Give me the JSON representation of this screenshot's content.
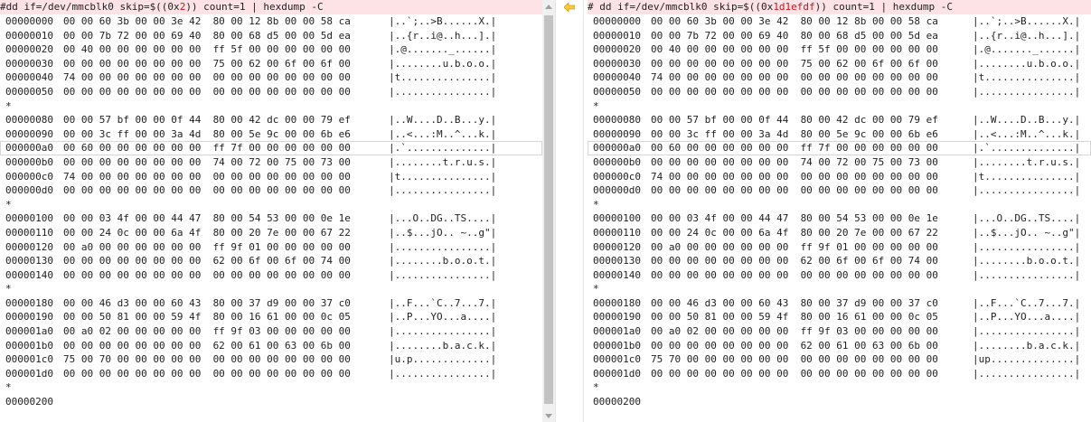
{
  "left": {
    "title_parts": [
      {
        "text": "#dd if=/dev/mmcblk0 skip=$((0x",
        "hl": false
      },
      {
        "text": "2",
        "hl": true
      },
      {
        "text": ")) count=1 | hexdump -C",
        "hl": false
      }
    ],
    "rows": [
      {
        "off": "00000000",
        "hex": "00 00 60 3b 00 00 3e 42  80 00 12 8b 00 00 58 ca",
        "asc": "|..`;..>B......X.|"
      },
      {
        "off": "00000010",
        "hex": "00 00 7b 72 00 00 69 40  80 00 68 d5 00 00 5d ea",
        "asc": "|..{r..i@..h...].|"
      },
      {
        "off": "00000020",
        "hex": "00 40 00 00 00 00 00 00  ff 5f 00 00 00 00 00 00",
        "asc": "|.@......._......|"
      },
      {
        "off": "00000030",
        "hex": "00 00 00 00 00 00 00 00  75 00 62 00 6f 00 6f 00",
        "asc": "|........u.b.o.o.|"
      },
      {
        "off": "00000040",
        "hex": "74 00 00 00 00 00 00 00  00 00 00 00 00 00 00 00",
        "asc": "|t...............|"
      },
      {
        "off": "00000050",
        "hex": "00 00 00 00 00 00 00 00  00 00 00 00 00 00 00 00",
        "asc": "|................|"
      },
      {
        "off": "*",
        "hex": "",
        "asc": ""
      },
      {
        "off": "00000080",
        "hex": "00 00 57 bf 00 00 0f 44  80 00 42 dc 00 00 79 ef",
        "asc": "|..W....D..B...y.|"
      },
      {
        "off": "00000090",
        "hex": "00 00 3c ff 00 00 3a 4d  80 00 5e 9c 00 00 6b e6",
        "asc": "|..<...:M..^...k.|"
      },
      {
        "off": "000000a0",
        "hex": "00 60 00 00 00 00 00 00  ff 7f 00 00 00 00 00 00",
        "asc": "|.`..............|"
      },
      {
        "off": "000000b0",
        "hex": "00 00 00 00 00 00 00 00  74 00 72 00 75 00 73 00",
        "asc": "|........t.r.u.s.|"
      },
      {
        "off": "000000c0",
        "hex": "74 00 00 00 00 00 00 00  00 00 00 00 00 00 00 00",
        "asc": "|t...............|"
      },
      {
        "off": "000000d0",
        "hex": "00 00 00 00 00 00 00 00  00 00 00 00 00 00 00 00",
        "asc": "|................|"
      },
      {
        "off": "*",
        "hex": "",
        "asc": ""
      },
      {
        "off": "00000100",
        "hex": "00 00 03 4f 00 00 44 47  80 00 54 53 00 00 0e 1e",
        "asc": "|...O..DG..TS....|"
      },
      {
        "off": "00000110",
        "hex": "00 00 24 0c 00 00 6a 4f  80 00 20 7e 00 00 67 22",
        "asc": "|..$...jO.. ~..g\"|"
      },
      {
        "off": "00000120",
        "hex": "00 a0 00 00 00 00 00 00  ff 9f 01 00 00 00 00 00",
        "asc": "|................|"
      },
      {
        "off": "00000130",
        "hex": "00 00 00 00 00 00 00 00  62 00 6f 00 6f 00 74 00",
        "asc": "|........b.o.o.t.|"
      },
      {
        "off": "00000140",
        "hex": "00 00 00 00 00 00 00 00  00 00 00 00 00 00 00 00",
        "asc": "|................|"
      },
      {
        "off": "*",
        "hex": "",
        "asc": ""
      },
      {
        "off": "00000180",
        "hex": "00 00 46 d3 00 00 60 43  80 00 37 d9 00 00 37 c0",
        "asc": "|..F...`C..7...7.|"
      },
      {
        "off": "00000190",
        "hex": "00 00 50 81 00 00 59 4f  80 00 16 61 00 00 0c 05",
        "asc": "|..P...YO...a....|"
      },
      {
        "off": "000001a0",
        "hex": "00 a0 02 00 00 00 00 00  ff 9f 03 00 00 00 00 00",
        "asc": "|................|"
      },
      {
        "off": "000001b0",
        "hex": "00 00 00 00 00 00 00 00  62 00 61 00 63 00 6b 00",
        "asc": "|........b.a.c.k.|"
      },
      {
        "off": "000001c0",
        "hex": "75 00 70 00 00 00 00 00  00 00 00 00 00 00 00 00",
        "asc": "|u.p.............|"
      },
      {
        "off": "000001d0",
        "hex": "00 00 00 00 00 00 00 00  00 00 00 00 00 00 00 00",
        "asc": "|................|"
      },
      {
        "off": "*",
        "hex": "",
        "asc": ""
      },
      {
        "off": "00000200",
        "hex": "",
        "asc": ""
      }
    ]
  },
  "right": {
    "title_parts": [
      {
        "text": "# dd if=/dev/mmcblk0 skip=$((0x",
        "hl": false
      },
      {
        "text": "1d1efdf",
        "hl": true
      },
      {
        "text": ")) count=1 | hexdump -C",
        "hl": false
      }
    ],
    "rows": [
      {
        "off": "00000000",
        "hex": "00 00 60 3b 00 00 3e 42  80 00 12 8b 00 00 58 ca",
        "asc": "|..`;..>B......X.|"
      },
      {
        "off": "00000010",
        "hex": "00 00 7b 72 00 00 69 40  80 00 68 d5 00 00 5d ea",
        "asc": "|..{r..i@..h...].|"
      },
      {
        "off": "00000020",
        "hex": "00 40 00 00 00 00 00 00  ff 5f 00 00 00 00 00 00",
        "asc": "|.@......._......|"
      },
      {
        "off": "00000030",
        "hex": "00 00 00 00 00 00 00 00  75 00 62 00 6f 00 6f 00",
        "asc": "|........u.b.o.o.|"
      },
      {
        "off": "00000040",
        "hex": "74 00 00 00 00 00 00 00  00 00 00 00 00 00 00 00",
        "asc": "|t...............|"
      },
      {
        "off": "00000050",
        "hex": "00 00 00 00 00 00 00 00  00 00 00 00 00 00 00 00",
        "asc": "|................|"
      },
      {
        "off": "*",
        "hex": "",
        "asc": ""
      },
      {
        "off": "00000080",
        "hex": "00 00 57 bf 00 00 0f 44  80 00 42 dc 00 00 79 ef",
        "asc": "|..W....D..B...y.|"
      },
      {
        "off": "00000090",
        "hex": "00 00 3c ff 00 00 3a 4d  80 00 5e 9c 00 00 6b e6",
        "asc": "|..<...:M..^...k.|"
      },
      {
        "off": "000000a0",
        "hex": "00 60 00 00 00 00 00 00  ff 7f 00 00 00 00 00 00",
        "asc": "|.`..............|"
      },
      {
        "off": "000000b0",
        "hex": "00 00 00 00 00 00 00 00  74 00 72 00 75 00 73 00",
        "asc": "|........t.r.u.s.|"
      },
      {
        "off": "000000c0",
        "hex": "74 00 00 00 00 00 00 00  00 00 00 00 00 00 00 00",
        "asc": "|t...............|"
      },
      {
        "off": "000000d0",
        "hex": "00 00 00 00 00 00 00 00  00 00 00 00 00 00 00 00",
        "asc": "|................|"
      },
      {
        "off": "*",
        "hex": "",
        "asc": ""
      },
      {
        "off": "00000100",
        "hex": "00 00 03 4f 00 00 44 47  80 00 54 53 00 00 0e 1e",
        "asc": "|...O..DG..TS....|"
      },
      {
        "off": "00000110",
        "hex": "00 00 24 0c 00 00 6a 4f  80 00 20 7e 00 00 67 22",
        "asc": "|..$...jO.. ~..g\"|"
      },
      {
        "off": "00000120",
        "hex": "00 a0 00 00 00 00 00 00  ff 9f 01 00 00 00 00 00",
        "asc": "|................|"
      },
      {
        "off": "00000130",
        "hex": "00 00 00 00 00 00 00 00  62 00 6f 00 6f 00 74 00",
        "asc": "|........b.o.o.t.|"
      },
      {
        "off": "00000140",
        "hex": "00 00 00 00 00 00 00 00  00 00 00 00 00 00 00 00",
        "asc": "|................|"
      },
      {
        "off": "*",
        "hex": "",
        "asc": ""
      },
      {
        "off": "00000180",
        "hex": "00 00 46 d3 00 00 60 43  80 00 37 d9 00 00 37 c0",
        "asc": "|..F...`C..7...7.|"
      },
      {
        "off": "00000190",
        "hex": "00 00 50 81 00 00 59 4f  80 00 16 61 00 00 0c 05",
        "asc": "|..P...YO...a....|"
      },
      {
        "off": "000001a0",
        "hex": "00 a0 02 00 00 00 00 00  ff 9f 03 00 00 00 00 00",
        "asc": "|................|"
      },
      {
        "off": "000001b0",
        "hex": "00 00 00 00 00 00 00 00  62 00 61 00 63 00 6b 00",
        "asc": "|........b.a.c.k.|"
      },
      {
        "off": "000001c0",
        "hex": "75 70 00 00 00 00 00 00  00 00 00 00 00 00 00 00",
        "asc": "|up..............|"
      },
      {
        "off": "000001d0",
        "hex": "00 00 00 00 00 00 00 00  00 00 00 00 00 00 00 00",
        "asc": "|................|"
      },
      {
        "off": "*",
        "hex": "",
        "asc": ""
      },
      {
        "off": "00000200",
        "hex": "",
        "asc": ""
      }
    ]
  },
  "current_row_index": 9,
  "icons": {
    "sync_arrow": "arrow-left-icon",
    "scroll_up": "chevron-up-icon",
    "scroll_down": "chevron-down-icon"
  },
  "colors": {
    "title_bg": "#fde3e6",
    "highlight": "#d0101a",
    "sync_arrow": "#f0b400"
  }
}
